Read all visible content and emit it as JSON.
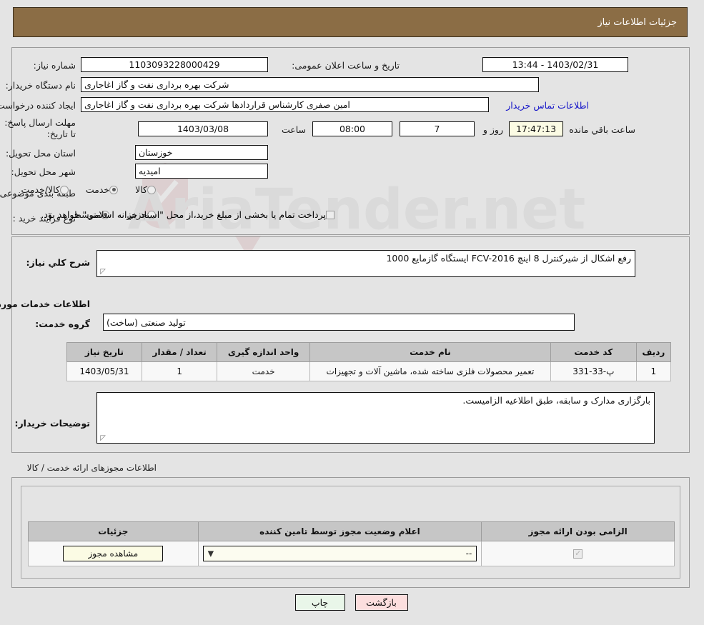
{
  "header": {
    "title": "جزئیات اطلاعات نیاز"
  },
  "watermark": {
    "text": "AriaTender.net"
  },
  "need_info": {
    "need_number_label": "شماره نیاز:",
    "need_number_value": "1103093228000429",
    "announce_label": "تاریخ و ساعت اعلان عمومی:",
    "announce_value": "1403/02/31 - 13:44",
    "buyer_org_label": "نام دستگاه خریدار:",
    "buyer_org_value": "شرکت بهره برداری نفت و گاز اغاجاری",
    "requester_label": "ایجاد کننده درخواست:",
    "requester_value": "امین صفری کارشناس قراردادها شرکت بهره برداری نفت و گاز اغاجاری",
    "contact_link": "اطلاعات تماس خریدار",
    "deadline_label": "مهلت ارسال پاسخ: تا تاریخ:",
    "deadline_date": "1403/03/08",
    "deadline_hour_label": "ساعت",
    "deadline_hour": "08:00",
    "remaining_days": "7",
    "remaining_days_label": "روز و",
    "remaining_time": "17:47:13",
    "remaining_time_label": "ساعت باقي مانده",
    "province_label": "استان محل تحویل:",
    "province_value": "خوزستان",
    "city_label": "شهر محل تحویل:",
    "city_value": "امیدیه",
    "category_label": "طبقه بندی موضوعی:",
    "category_options": [
      {
        "label": "کالا",
        "selected": false
      },
      {
        "label": "خدمت",
        "selected": true
      },
      {
        "label": "کالا/خدمت",
        "selected": false
      }
    ],
    "process_label": "نوع فرآیند خرید :",
    "process_options": [
      {
        "label": "جزیي",
        "selected": false
      },
      {
        "label": "متوسط",
        "selected": true
      }
    ],
    "treasury_checkbox_label": "پرداخت تمام یا بخشی از مبلغ خرید،از محل \"اسناد خزانه اسلامی\" خواهد بود.",
    "treasury_checked": false
  },
  "description": {
    "label": "شرح کلي نیاز:",
    "value": "رفع اشکال از شیرکنترل 8 اینچ FCV-2016 ایستگاه گازمایع 1000"
  },
  "services_section": {
    "heading": "اطلاعات خدمات مورد نیاز",
    "group_label": "گروه خدمت:",
    "group_value": "تولید صنعتی (ساخت)",
    "table": {
      "columns": [
        "ردیف",
        "کد خدمت",
        "نام خدمت",
        "واحد اندازه گیری",
        "تعداد / مقدار",
        "تاریخ نیاز"
      ],
      "rows": [
        {
          "row": "1",
          "code": "پ-33-331",
          "name": "تعمیر محصولات فلزی ساخته شده، ماشین آلات و تجهیزات",
          "unit": "خدمت",
          "quantity": "1",
          "need_date": "1403/05/31"
        }
      ]
    }
  },
  "buyer_notes": {
    "label": "توضیحات خریدار:",
    "value": "بارگزاری مدارک و سابقه، طبق اطلاعیه الزامیست."
  },
  "permits_section": {
    "heading": "اطلاعات مجوزهای ارائه خدمت / کالا",
    "table": {
      "columns": [
        "الزامی بودن ارائه مجوز",
        "اعلام وضعیت مجوز توسط تامین کننده",
        "جزئیات"
      ],
      "rows": [
        {
          "required_checked": true,
          "status_value": "--",
          "status_options": [
            "--"
          ],
          "detail_button": "مشاهده مجوز"
        }
      ]
    }
  },
  "footer": {
    "print_label": "چاپ",
    "back_label": "بازگشت"
  },
  "colors": {
    "header_bg": "#8b6d45",
    "page_bg": "#e4e4e4",
    "link": "#1414c8",
    "table_header": "#c6c6c6",
    "highlight_field": "#fbfbe4",
    "print_button": "#e9f6e9",
    "back_button": "#fcdede"
  }
}
